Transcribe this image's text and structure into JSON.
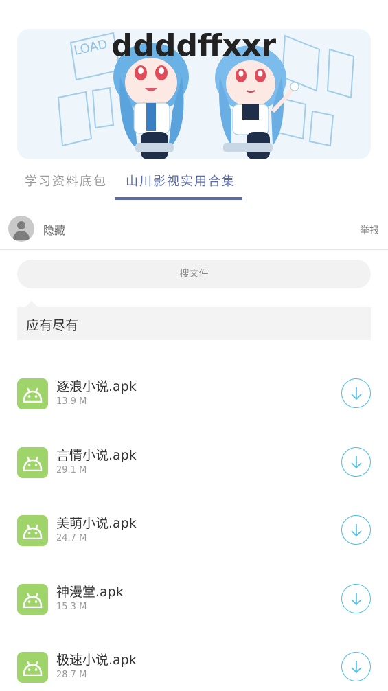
{
  "banner": {
    "overlay_text": "ddddffxxr",
    "image_icon": "anime-banner-image"
  },
  "tabs": [
    {
      "label": "学习资料底包",
      "active": false
    },
    {
      "label": "山川影视实用合集",
      "active": true
    }
  ],
  "author": {
    "name": "隐藏",
    "avatar_icon": "user-avatar-icon",
    "report_label": "举报"
  },
  "search": {
    "placeholder": "搜文件"
  },
  "description": "应有尽有",
  "files": [
    {
      "name": "逐浪小说.apk",
      "size": "13.9 M",
      "icon": "android-icon"
    },
    {
      "name": "言情小说.apk",
      "size": "29.1 M",
      "icon": "android-icon"
    },
    {
      "name": "美萌小说.apk",
      "size": "24.7 M",
      "icon": "android-icon"
    },
    {
      "name": "神漫堂.apk",
      "size": "15.3 M",
      "icon": "android-icon"
    },
    {
      "name": "极速小说.apk",
      "size": "28.7 M",
      "icon": "android-icon"
    }
  ],
  "colors": {
    "accent": "#5a6aa8",
    "android_green": "#9ed46a",
    "download_blue": "#49c0e8"
  }
}
